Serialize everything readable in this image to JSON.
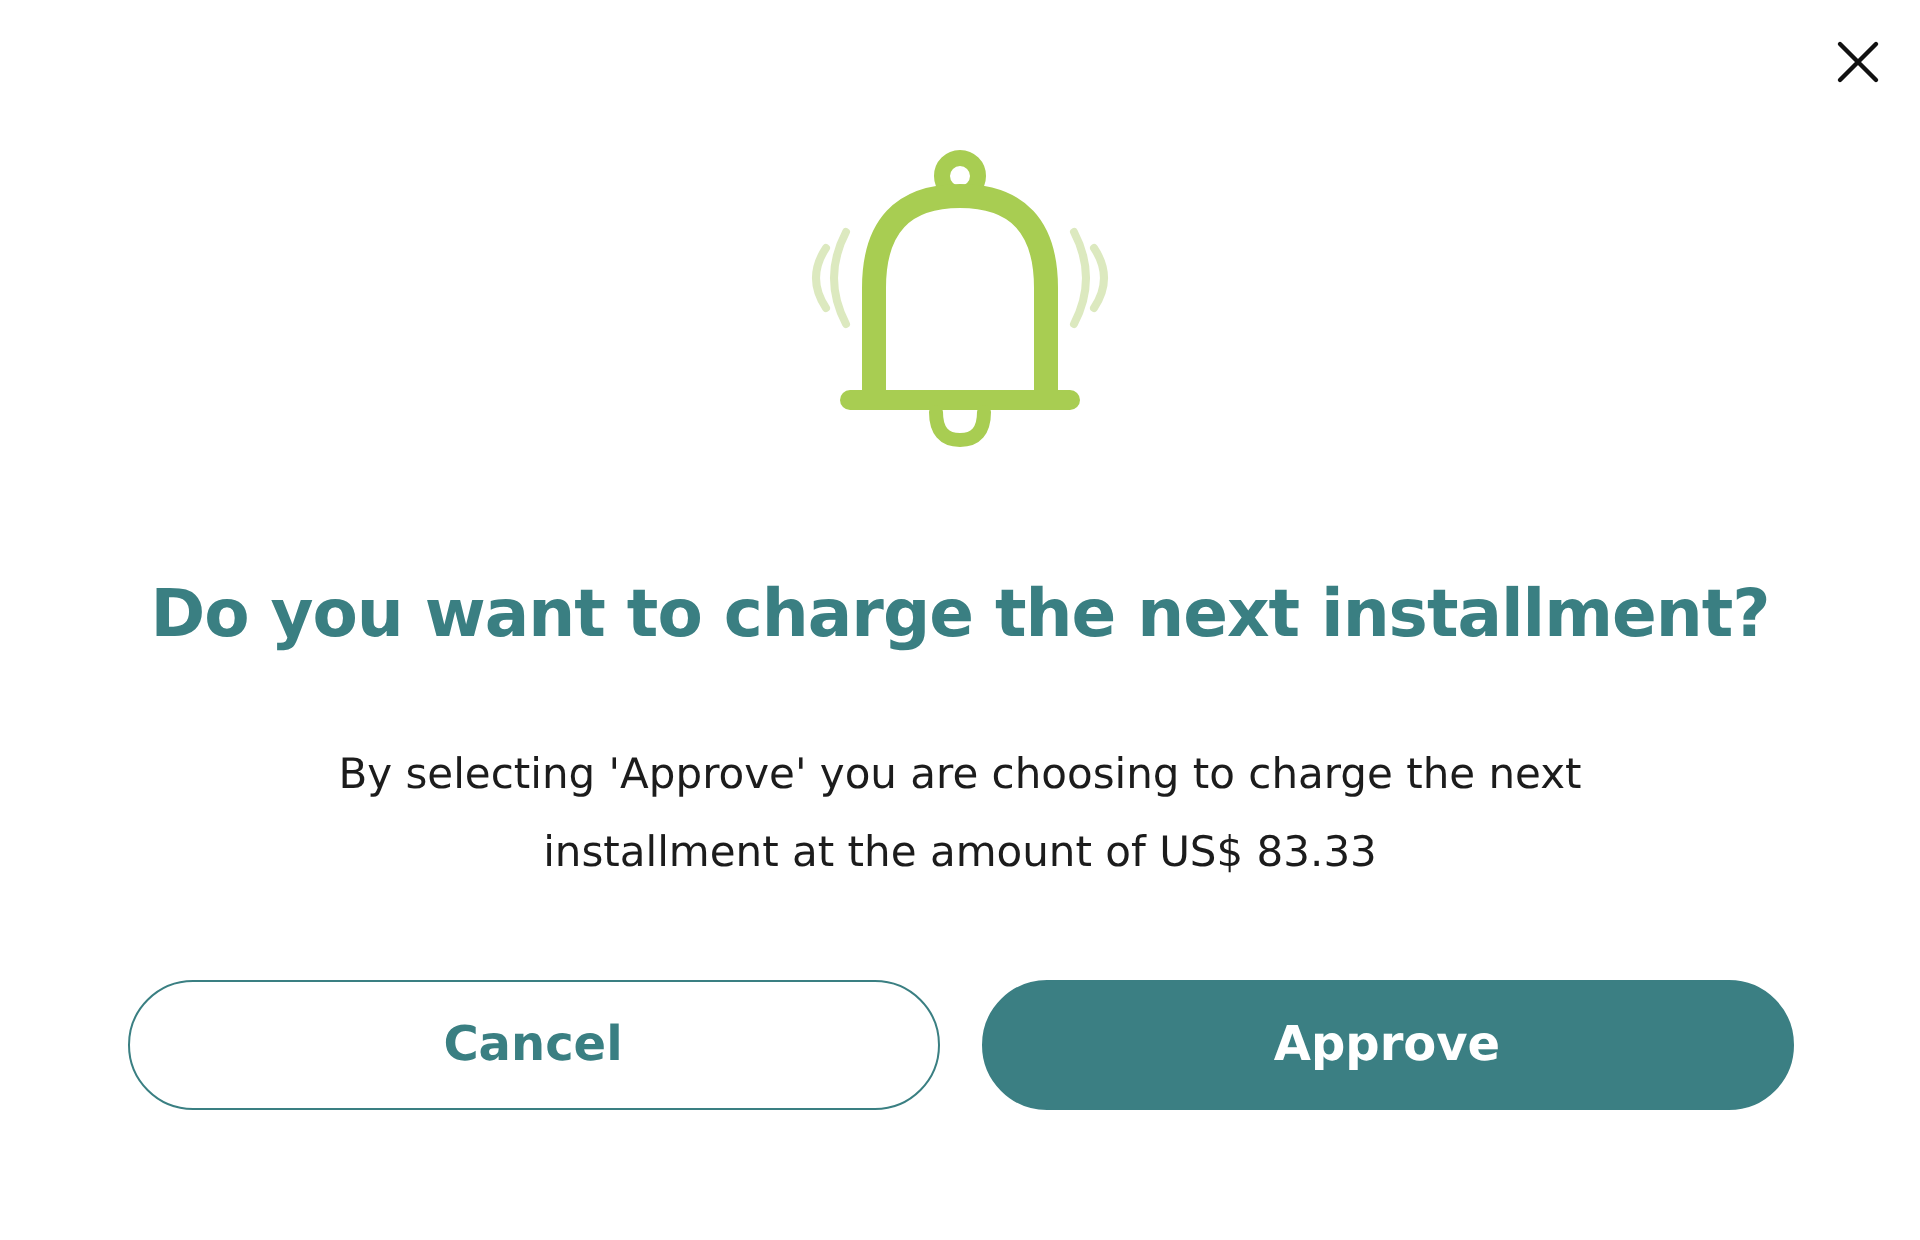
{
  "dialog": {
    "title": "Do you want to charge the next installment?",
    "message": "By selecting 'Approve' you are choosing to charge the next installment at the amount of US$ 83.33",
    "buttons": [
      {
        "label": "Cancel",
        "kind": "secondary"
      },
      {
        "label": "Approve",
        "kind": "primary"
      }
    ]
  }
}
